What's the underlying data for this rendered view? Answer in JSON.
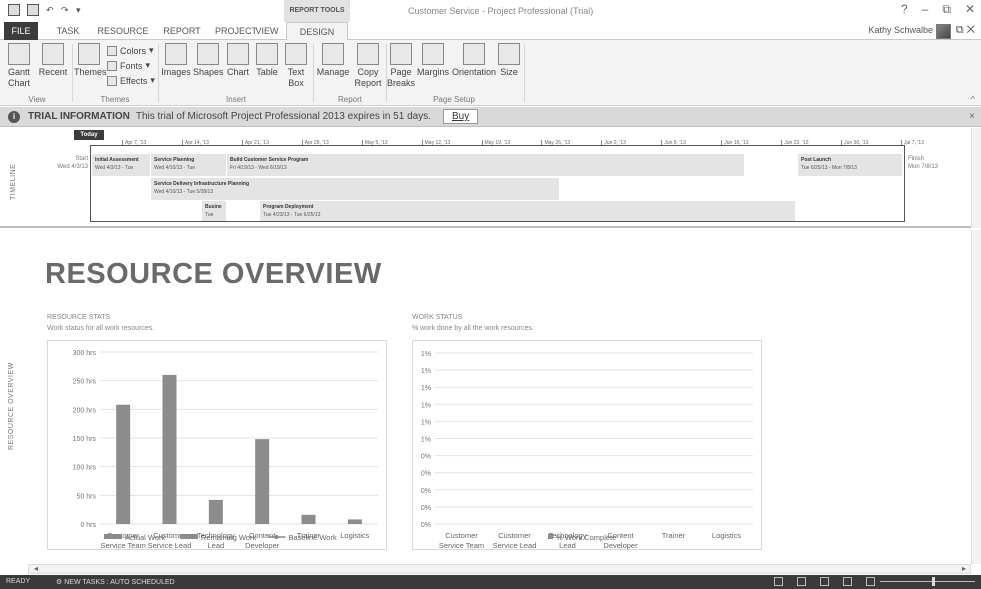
{
  "window": {
    "title": "Customer Service - Project Professional (Trial)",
    "contextual_tab_group": "REPORT TOOLS",
    "user_name": "Kathy Schwalbe",
    "controls": [
      "?",
      "–",
      "⧉",
      "✕"
    ]
  },
  "tabs": [
    "FILE",
    "TASK",
    "RESOURCE",
    "REPORT",
    "PROJECT",
    "VIEW",
    "DESIGN"
  ],
  "ribbon": {
    "view": {
      "gantt_chart": "Gantt Chart",
      "recent": "Recent",
      "group": "View"
    },
    "themes": {
      "themes": "Themes",
      "colors": "Colors",
      "fonts": "Fonts",
      "effects": "Effects",
      "group": "Themes"
    },
    "insert": {
      "images": "Images",
      "shapes": "Shapes",
      "chart": "Chart",
      "table": "Table",
      "text_box": "Text Box",
      "group": "Insert"
    },
    "report": {
      "manage": "Manage",
      "copy_report": "Copy Report",
      "group": "Report"
    },
    "page_setup": {
      "page_breaks": "Page Breaks",
      "margins": "Margins",
      "orientation": "Orientation",
      "size": "Size",
      "group": "Page Setup"
    }
  },
  "trial": {
    "title": "TRIAL INFORMATION",
    "message": "This trial of Microsoft Project Professional 2013 expires in 51 days.",
    "buy_label": "Buy"
  },
  "timeline": {
    "label": "TIMELINE",
    "today": "Today",
    "start_label": "Start",
    "start_date": "Wed 4/3/13",
    "finish_label": "Finish",
    "finish_date": "Mon 7/8/13",
    "ticks": [
      "Apr 7, '13",
      "Apr 14, '13",
      "Apr 21, '13",
      "Apr 28, '13",
      "May 5, '13",
      "May 12, '13",
      "May 19, '13",
      "May 26, '13",
      "Jun 2, '13",
      "Jun 9, '13",
      "Jun 16, '13",
      "Jun 23, '13",
      "Jun 30, '13",
      "Jul 7, '13"
    ],
    "tasks": [
      {
        "name": "Initial Assessment",
        "dates": "Wed 4/3/13 - Tue"
      },
      {
        "name": "Service Planning",
        "dates": "Wed 4/10/13 - Tue"
      },
      {
        "name": "Build Customer Service Program",
        "dates": "Fri 4/19/13 - Wed 6/19/13"
      },
      {
        "name": "Post Launch",
        "dates": "Tue 6/25/13 - Mon 7/8/13"
      },
      {
        "name": "Service Delivery Infrastructure Planning",
        "dates": "Wed 4/10/13 - Tue 5/28/13"
      },
      {
        "name": "Busine",
        "dates": "Tue"
      },
      {
        "name": "Program Deployment",
        "dates": "Tue 4/23/13 - Tue 6/25/13"
      }
    ]
  },
  "report": {
    "side_label": "RESOURCE OVERVIEW",
    "title": "RESOURCE OVERVIEW",
    "stats_title": "RESOURCE STATS",
    "stats_sub": "Work status for all work resources.",
    "work_title": "WORK STATUS",
    "work_sub": "% work done by all the work resources."
  },
  "chart_data": [
    {
      "type": "bar",
      "categories": [
        "Customer Service Team",
        "Customer Service Lead",
        "Technology Lead",
        "Content Developer",
        "Trainer",
        "Logistics"
      ],
      "category_lines": [
        [
          "Customer",
          "Service Team"
        ],
        [
          "Customer",
          "Service Lead"
        ],
        [
          "Technology",
          "Lead"
        ],
        [
          "Content",
          "Developer"
        ],
        [
          "Trainer"
        ],
        [
          "Logistics"
        ]
      ],
      "series": [
        {
          "name": "Actual Work",
          "values": [
            0,
            0,
            0,
            0,
            0,
            0
          ]
        },
        {
          "name": "Remaining Work",
          "values": [
            208,
            260,
            42,
            148,
            16,
            8
          ]
        },
        {
          "name": "Baseline Work",
          "values": [
            0,
            0,
            0,
            0,
            0,
            0
          ]
        }
      ],
      "yticks": [
        "0 hrs",
        "50 hrs",
        "100 hrs",
        "150 hrs",
        "200 hrs",
        "250 hrs",
        "300 hrs"
      ],
      "ylim": [
        0,
        300
      ],
      "legend_position": "bottom",
      "colors": {
        "bars": "#8c8c8c",
        "grid": "#e3e3e3"
      }
    },
    {
      "type": "bar",
      "categories": [
        "Customer Service Team",
        "Customer Service Lead",
        "Technology Lead",
        "Content Developer",
        "Trainer",
        "Logistics"
      ],
      "category_lines": [
        [
          "Customer",
          "Service Team"
        ],
        [
          "Customer",
          "Service Lead"
        ],
        [
          "Technology",
          "Lead"
        ],
        [
          "Content",
          "Developer"
        ],
        [
          "Trainer"
        ],
        [
          "Logistics"
        ]
      ],
      "series": [
        {
          "name": "% Work Complete",
          "values": [
            0,
            0,
            0,
            0,
            0,
            0
          ]
        }
      ],
      "yticks": [
        "0%",
        "0%",
        "0%",
        "0%",
        "0%",
        "1%",
        "1%",
        "1%",
        "1%",
        "1%",
        "1%"
      ],
      "legend_position": "bottom",
      "colors": {
        "bars": "#8c8c8c",
        "grid": "#e3e3e3"
      }
    }
  ],
  "status": {
    "ready": "READY",
    "new_tasks": "NEW TASKS : AUTO SCHEDULED"
  }
}
